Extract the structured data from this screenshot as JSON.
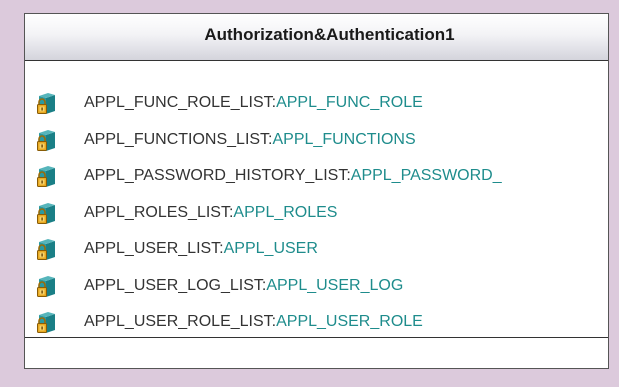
{
  "class": {
    "title": "Authorization&Authentication1",
    "attributes": [
      {
        "name": "APPL_FUNC_ROLE_LIST:",
        "type": "APPL_FUNC_ROLE",
        "icon": "protected-attribute-icon"
      },
      {
        "name": "APPL_FUNCTIONS_LIST:",
        "type": "APPL_FUNCTIONS",
        "icon": "protected-attribute-icon"
      },
      {
        "name": "APPL_PASSWORD_HISTORY_LIST:",
        "type": "APPL_PASSWORD_",
        "icon": "protected-attribute-icon"
      },
      {
        "name": "APPL_ROLES_LIST:",
        "type": "APPL_ROLES",
        "icon": "protected-attribute-icon"
      },
      {
        "name": "APPL_USER_LIST:",
        "type": "APPL_USER",
        "icon": "protected-attribute-icon"
      },
      {
        "name": "APPL_USER_LOG_LIST:",
        "type": "APPL_USER_LOG",
        "icon": "protected-attribute-icon"
      },
      {
        "name": "APPL_USER_ROLE_LIST:",
        "type": "APPL_USER_ROLE",
        "icon": "protected-attribute-icon"
      }
    ]
  },
  "colors": {
    "background": "#dccadc",
    "attribute_name": "#333333",
    "attribute_type": "#1e8c8c",
    "icon_cube": "#1a7f86",
    "icon_lock": "#e0a21c"
  }
}
